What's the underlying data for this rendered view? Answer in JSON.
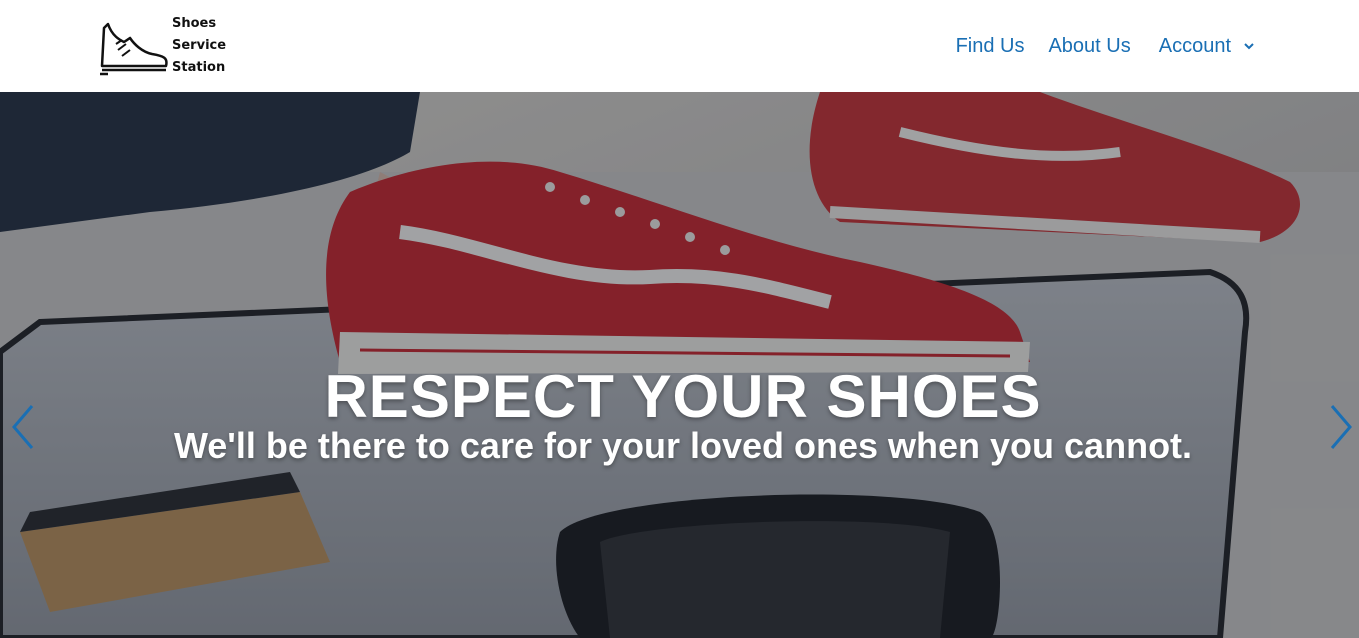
{
  "brand": {
    "line1": "Shoes",
    "line2": "Service",
    "line3": "Station"
  },
  "nav": {
    "find_us": "Find Us",
    "about_us": "About Us",
    "account": "Account"
  },
  "hero": {
    "title": "RESPECT YOUR SHOES",
    "subtitle": "We'll be there to care for your loved ones when you cannot."
  },
  "colors": {
    "nav_link": "#1a6fb4",
    "arrow": "#1a6fb4",
    "hero_text": "#ffffff"
  },
  "icons": {
    "logo": "sneaker-outline-icon",
    "account_dropdown": "chevron-down-icon",
    "carousel_prev": "chevron-left-icon",
    "carousel_next": "chevron-right-icon"
  }
}
